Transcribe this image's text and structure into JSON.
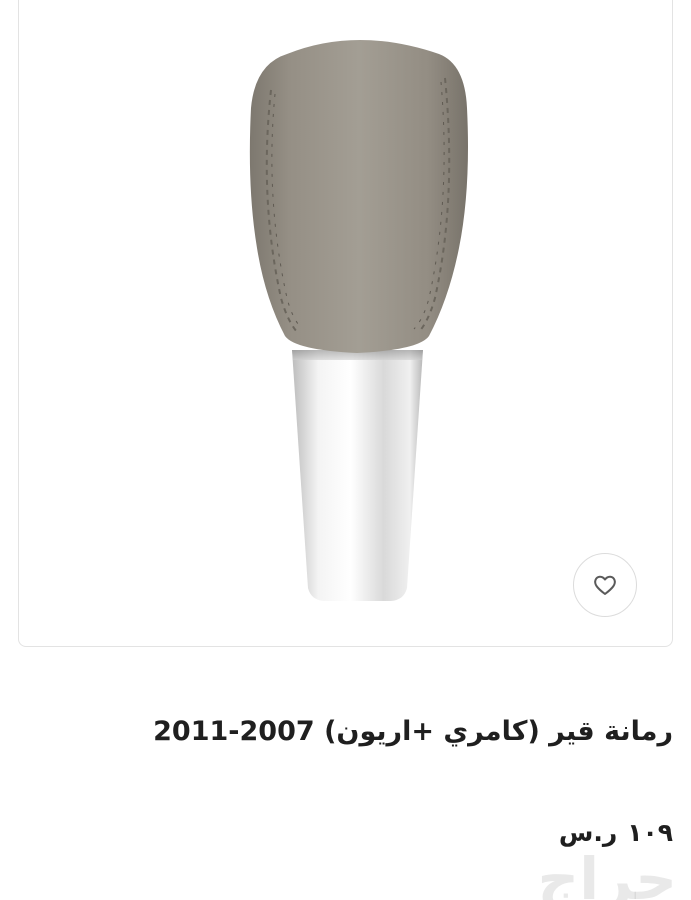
{
  "product": {
    "title": "رمانة قير (كامري +اريون) 2007-2011",
    "price_value": "١٠٩",
    "price_currency": "ر.س"
  },
  "favorite": {
    "icon": "heart-outline-icon"
  },
  "watermark": {
    "text": "حراج"
  },
  "colors": {
    "leather": "#9b968d",
    "chrome": "#e6e6e6",
    "text": "#1f1f1f",
    "card_border": "#e3e3e3"
  }
}
